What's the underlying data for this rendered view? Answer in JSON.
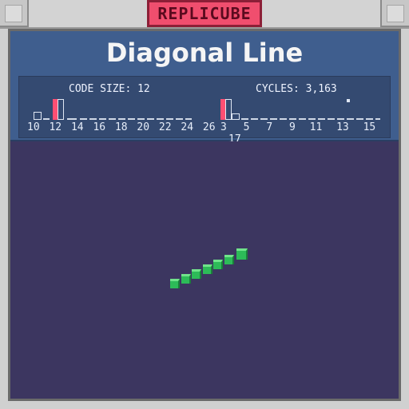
{
  "app": {
    "title": "REPLICUBE"
  },
  "level": {
    "title": "Diagonal Line"
  },
  "stats": {
    "code_size": {
      "label": "CODE SIZE: 12",
      "ticks": [
        "10",
        "12",
        "14",
        "16",
        "18",
        "20",
        "22",
        "24",
        "26"
      ]
    },
    "cycles": {
      "label": "CYCLES: 3,163",
      "ticks": [
        "3",
        "5",
        "7",
        "9",
        "11",
        "13",
        "15",
        "17"
      ]
    }
  },
  "colors": {
    "accent": "#f04e6e",
    "header": "#3f5e8e",
    "board": "#3c3660",
    "cube": "#2dbb58"
  }
}
